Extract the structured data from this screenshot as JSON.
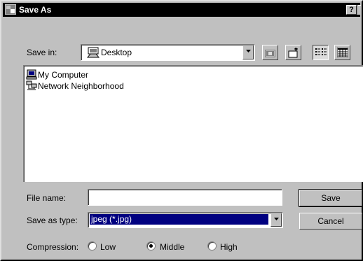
{
  "window": {
    "title": "Save As",
    "help_label": "?"
  },
  "save_in": {
    "label": "Save in:",
    "value": "Desktop"
  },
  "files": [
    {
      "name": "My Computer",
      "icon": "computer-icon"
    },
    {
      "name": "Network Neighborhood",
      "icon": "network-icon"
    }
  ],
  "file_name": {
    "label": "File name:",
    "value": ""
  },
  "save_type": {
    "label": "Save as type:",
    "value": "jpeg (*.jpg)"
  },
  "buttons": {
    "save": "Save",
    "cancel": "Cancel"
  },
  "compression": {
    "label": "Compression:",
    "options": [
      "Low",
      "Middle",
      "High"
    ],
    "selected": "Middle"
  },
  "colors": {
    "titlebar": "#000000",
    "face": "#c0c0c0",
    "selection": "#000080"
  }
}
